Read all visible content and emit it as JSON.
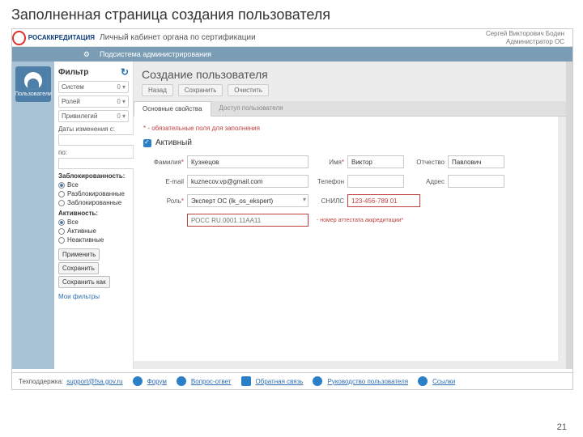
{
  "slide_title": "Заполненная страница создания пользователя",
  "header": {
    "logo_text": "РОСАККРЕДИТАЦИЯ",
    "title": "Личный кабинет органа по сертификации",
    "user_name": "Сергей Викторович Бодин",
    "user_role": "Администратор ОС"
  },
  "subheader": "Подсистема администрирования",
  "rail_item": "Пользователи",
  "sidebar": {
    "title": "Фильтр",
    "selects": [
      {
        "label": "Систем",
        "count": "0  ▾"
      },
      {
        "label": "Ролей",
        "count": "0  ▾"
      },
      {
        "label": "Привилегий",
        "count": "0  ▾"
      }
    ],
    "dates_label": "Даты изменения с:",
    "dates_to": "по:",
    "blocked_title": "Заблокированность:",
    "blocked_opts": [
      "Все",
      "Разблокированные",
      "Заблокированные"
    ],
    "blocked_sel": 0,
    "active_title": "Активность:",
    "active_opts": [
      "Все",
      "Активные",
      "Неактивные"
    ],
    "active_sel": 0,
    "btns": [
      "Применить",
      "Сохранить",
      "Сохранить как"
    ],
    "link": "Мои фильтры"
  },
  "main": {
    "title": "Создание пользователя",
    "toolbar": [
      "Назад",
      "Сохранить",
      "Очистить"
    ],
    "tabs": [
      "Основные свойства",
      "Доступ пользователя"
    ],
    "active_tab": 0,
    "required_note": "* - обязательные поля для заполнения",
    "active_chk": "Активный"
  },
  "form": {
    "surname_lbl": "Фамилия",
    "surname": "Кузнецов",
    "name_lbl": "Имя",
    "name": "Виктор",
    "patronymic_lbl": "Отчество",
    "patronymic": "Павлович",
    "email_lbl": "E-mail",
    "email": "kuznecov.vp@gmail.com",
    "phone_lbl": "Телефон",
    "phone": "",
    "address_lbl": "Адрес",
    "address": "",
    "role_lbl": "Роль",
    "role": "Эксперт ОС (lk_os_ekspert)",
    "snils_lbl": "СНИЛС",
    "snils": "123-456-789 01",
    "attestat_placeholder": "РОСС RU.0001.11АА11",
    "attestat_note": "- номер аттестата аккредитации*"
  },
  "footer": {
    "support_lbl": "Техподдержка:",
    "support_email": "support@fsa.gov.ru",
    "links": [
      "Форум",
      "Вопрос-ответ",
      "Обратная связь",
      "Руководство пользователя",
      "Ссылки"
    ]
  },
  "page_number": "21"
}
